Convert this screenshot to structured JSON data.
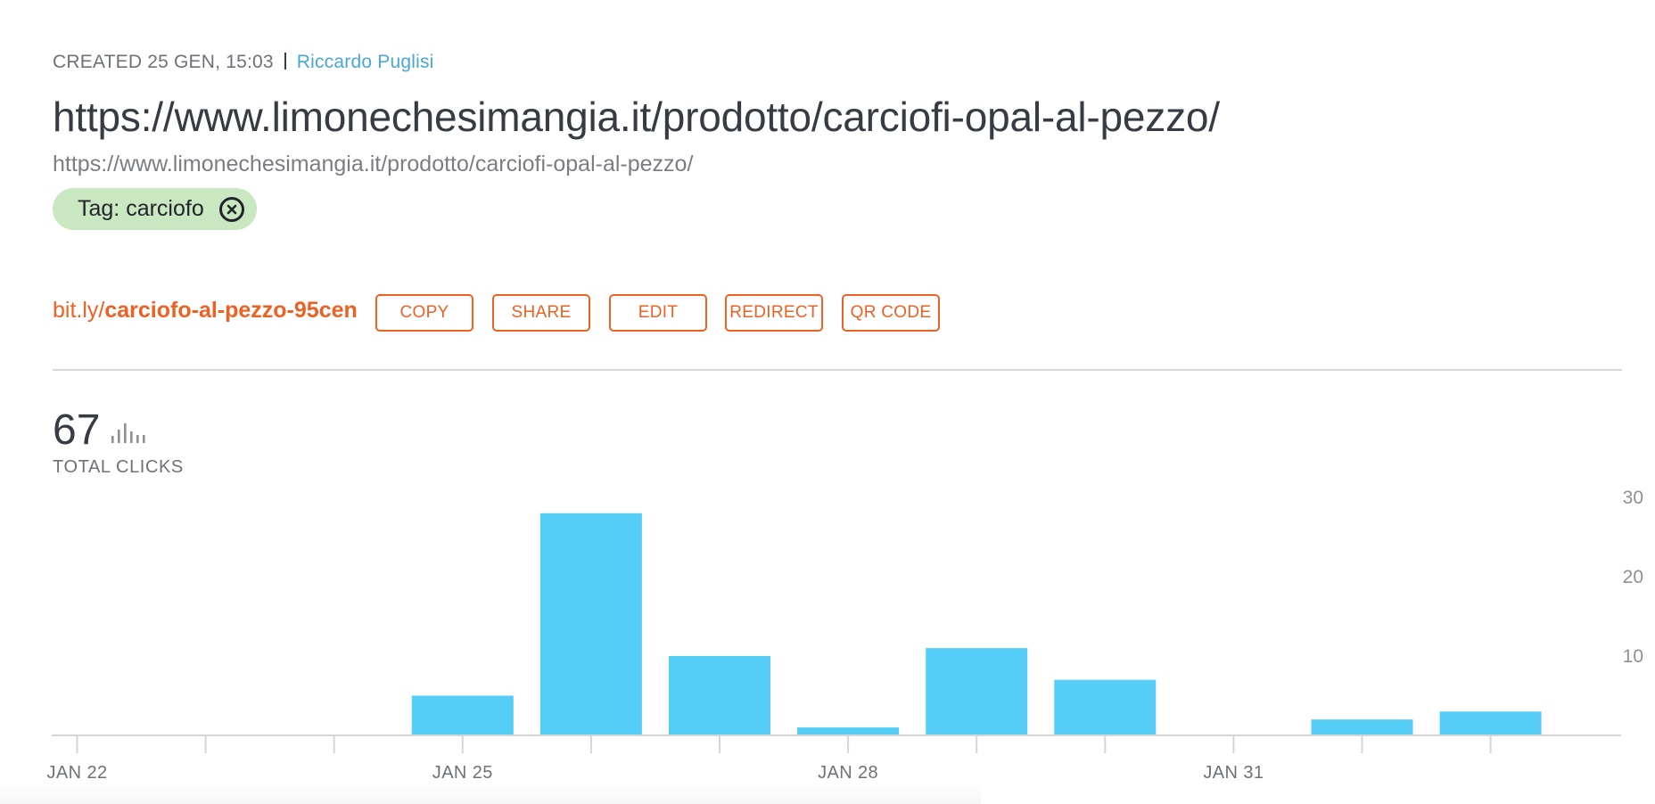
{
  "header": {
    "created": "CREATED 25 GEN, 15:03",
    "author": "Riccardo Puglisi",
    "title": "https://www.limonechesimangia.it/prodotto/carciofi-opal-al-pezzo/",
    "long_url": "https://www.limonechesimangia.it/prodotto/carciofi-opal-al-pezzo/"
  },
  "tag": {
    "label": "Tag: carciofo",
    "remove_icon": "close-circle-icon"
  },
  "link": {
    "domain": "bit.ly/",
    "slug": "carciofo-al-pezzo-95cen",
    "buttons": [
      "COPY",
      "SHARE",
      "EDIT",
      "REDIRECT",
      "QR CODE"
    ]
  },
  "stats": {
    "total_clicks": "67",
    "total_label": "TOTAL CLICKS",
    "icon": "bar-chart-icon"
  },
  "colors": {
    "accent": "#ee6123",
    "bar": "#56cdf7",
    "tag_bg": "#c9e7c0",
    "author": "#4aa6d9"
  },
  "chart_data": {
    "type": "bar",
    "categories": [
      "JAN 22",
      "JAN 23",
      "JAN 24",
      "JAN 25",
      "JAN 26",
      "JAN 27",
      "JAN 28",
      "JAN 29",
      "JAN 30",
      "JAN 31",
      "FEB 1",
      "FEB 2"
    ],
    "values": [
      0,
      0,
      0,
      5,
      28,
      10,
      1,
      11,
      7,
      0,
      2,
      3
    ],
    "x_tick_labels": [
      "JAN 22",
      "JAN 25",
      "JAN 28",
      "JAN 31"
    ],
    "y_ticks": [
      10,
      20,
      30
    ],
    "ylim": [
      0,
      30
    ],
    "grid": false,
    "y_axis_position": "right"
  }
}
